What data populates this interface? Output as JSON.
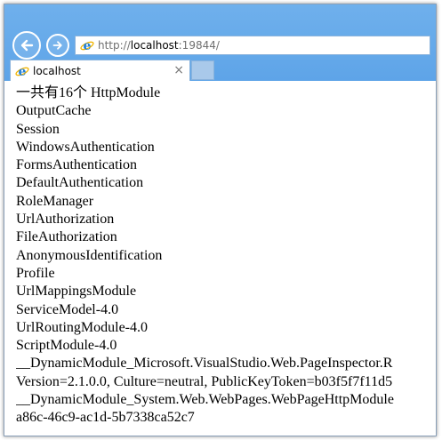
{
  "browser": {
    "address": {
      "prefix": "http://",
      "host": "localhost",
      "port": ":19844/"
    },
    "tab": {
      "title": "localhost",
      "close": "×"
    },
    "accent": "#5ea4e8"
  },
  "page": {
    "lines": [
      "一共有16个 HttpModule",
      "OutputCache",
      "Session",
      "WindowsAuthentication",
      "FormsAuthentication",
      "DefaultAuthentication",
      "RoleManager",
      "UrlAuthorization",
      "FileAuthorization",
      "AnonymousIdentification",
      "Profile",
      "UrlMappingsModule",
      "ServiceModel-4.0",
      "UrlRoutingModule-4.0",
      "ScriptModule-4.0",
      "__DynamicModule_Microsoft.VisualStudio.Web.PageInspector.R",
      "Version=2.1.0.0, Culture=neutral, PublicKeyToken=b03f5f7f11d5",
      "__DynamicModule_System.Web.WebPages.WebPageHttpModule",
      "a86c-46c9-ac1d-5b7338ca52c7"
    ]
  }
}
